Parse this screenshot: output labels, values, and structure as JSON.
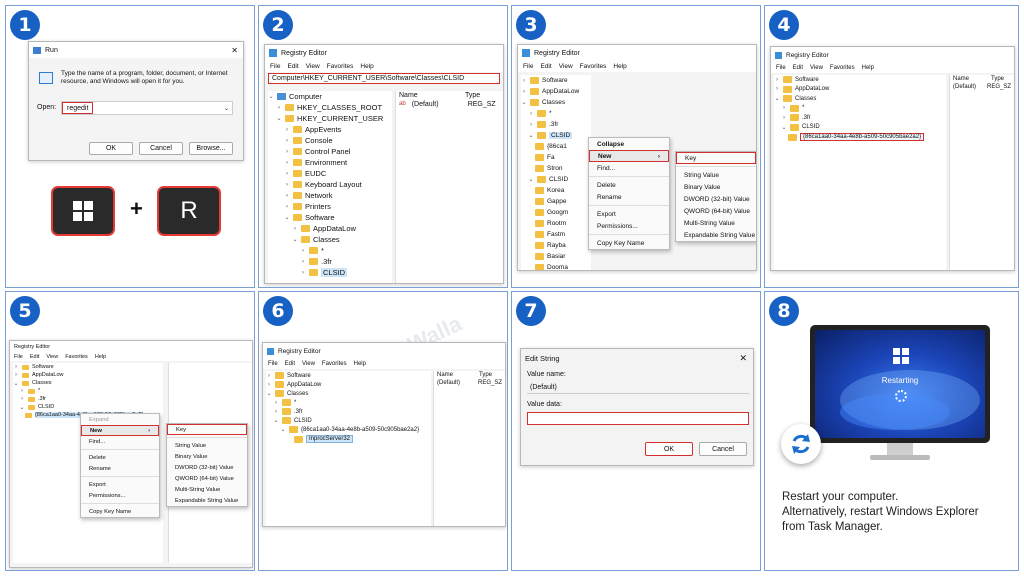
{
  "steps": [
    "1",
    "2",
    "3",
    "4",
    "5",
    "6",
    "7",
    "8"
  ],
  "run": {
    "title": "Run",
    "description": "Type the name of a program, folder, document, or Internet resource, and Windows will open it for you.",
    "open_label": "Open:",
    "open_value": "regedit",
    "ok": "OK",
    "cancel": "Cancel",
    "browse": "Browse..."
  },
  "keys": {
    "win_key": "win-key",
    "plus": "+",
    "r_key": "R"
  },
  "regedit": {
    "title": "Registry Editor",
    "menu": [
      "File",
      "Edit",
      "View",
      "Favorites",
      "Help"
    ],
    "address": "Computer\\HKEY_CURRENT_USER\\Software\\Classes\\CLSID",
    "col_name": "Name",
    "col_type": "Type",
    "default_name": "(Default)",
    "default_type": "REG_SZ"
  },
  "tree2": [
    "Computer",
    "HKEY_CLASSES_ROOT",
    "HKEY_CURRENT_USER",
    "AppEvents",
    "Console",
    "Control Panel",
    "Environment",
    "EUDC",
    "Keyboard Layout",
    "Network",
    "Printers",
    "Software",
    "AppDataLow",
    "Classes",
    "*",
    ".3fr",
    "CLSID"
  ],
  "tree3": [
    "Software",
    "AppDataLow",
    "Classes",
    "*",
    ".3fr",
    "CLSID",
    "{86ca1",
    "Fa",
    "Stron",
    "CLSID",
    "Korea",
    "Gappe",
    "Googm",
    "Rootm",
    "Fastm",
    "Rayba",
    "Basiar",
    "Dooma"
  ],
  "ctx3": {
    "collapse": "Collapse",
    "new": "New",
    "find": "Find...",
    "delete": "Delete",
    "rename": "Rename",
    "export": "Export",
    "permissions": "Permissions...",
    "copy": "Copy Key Name"
  },
  "submenu": [
    "Key",
    "String Value",
    "Binary Value",
    "DWORD (32-bit) Value",
    "QWORD (64-bit) Value",
    "Multi-String Value",
    "Expandable String Value"
  ],
  "tree4": [
    "Software",
    "AppDataLow",
    "Classes",
    "*",
    ".3fr",
    "CLSID",
    "{86ca1aa0-34aa-4e8b-a509-50c905bae2a2}"
  ],
  "ctx5": {
    "expand": "Expand",
    "new": "New",
    "find": "Find...",
    "delete": "Delete",
    "rename": "Rename",
    "export": "Export",
    "permissions": "Permissions...",
    "copy": "Copy Key Name"
  },
  "tree6": [
    "Software",
    "AppDataLow",
    "Classes",
    "*",
    ".3fr",
    "CLSID",
    "{86ca1aa0-34aa-4e8b-a509-50c905bae2a2}",
    "InprocServer32"
  ],
  "edit": {
    "title": "Edit String",
    "value_name_label": "Value name:",
    "value_name": "(Default)",
    "value_data_label": "Value data:",
    "value_data": "",
    "ok": "OK",
    "cancel": "Cancel"
  },
  "restart": {
    "status": "Restarting",
    "line1": "Restart your computer.",
    "line2": "Alternatively, restart Windows Explorer",
    "line3": "from Task Manager."
  },
  "watermark": "TechWalla"
}
